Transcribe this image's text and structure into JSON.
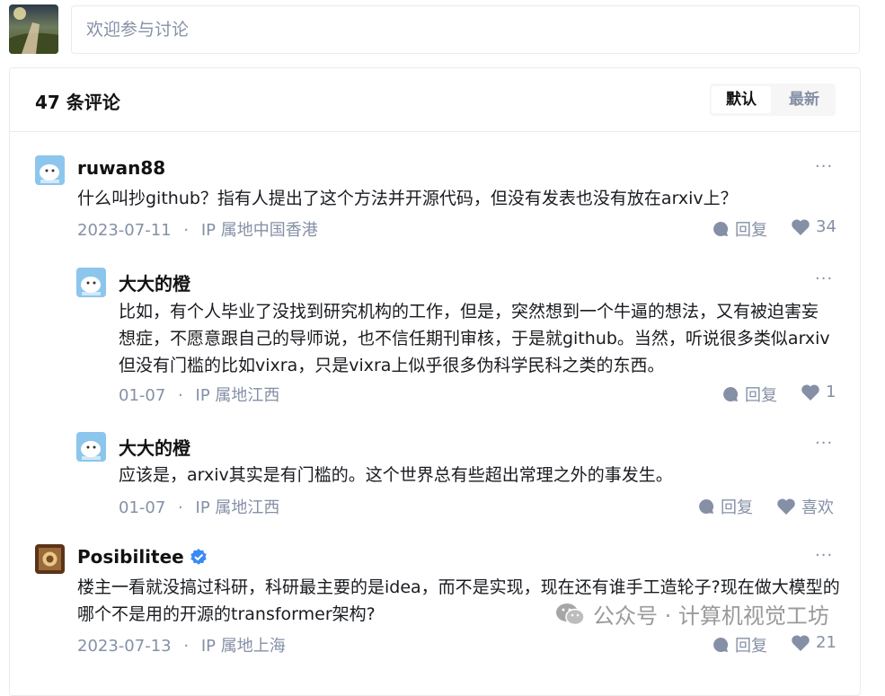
{
  "input": {
    "placeholder": "欢迎参与讨论"
  },
  "header": {
    "count_label": "47 条评论",
    "sort_default": "默认",
    "sort_latest": "最新"
  },
  "comments": [
    {
      "author": "ruwan88",
      "content": "什么叫抄github？指有人提出了这个方法并开源代码，但没有发表也没有放在arxiv上？",
      "date": "2023-07-11",
      "ip": "IP 属地中国香港",
      "reply": "回复",
      "likes": "34"
    },
    {
      "author": "大大的橙",
      "content": "比如，有个人毕业了没找到研究机构的工作，但是，突然想到一个牛逼的想法，又有被迫害妄想症，不愿意跟自己的导师说，也不信任期刊审核，于是就github。当然，听说很多类似arxiv但没有门槛的比如vixra，只是vixra上似乎很多伪科学民科之类的东西。",
      "date": "01-07",
      "ip": "IP 属地江西",
      "reply": "回复",
      "likes": "1"
    },
    {
      "author": "大大的橙",
      "content": "应该是，arxiv其实是有门槛的。这个世界总有些超出常理之外的事发生。",
      "date": "01-07",
      "ip": "IP 属地江西",
      "reply": "回复",
      "likes": "喜欢"
    },
    {
      "author": "Posibilitee",
      "content": "楼主一看就没搞过科研，科研最主要的是idea，而不是实现，现在还有谁手工造轮子?现在做大模型的哪个不是用的开源的transformer架构?",
      "date": "2023-07-13",
      "ip": "IP 属地上海",
      "reply": "回复",
      "likes": "21"
    }
  ],
  "separator": "·",
  "more_glyph": "···",
  "watermark": "公众号 · 计算机视觉工坊",
  "colors": {
    "muted": "#8590a6",
    "verified": "#3a8af5",
    "text": "#191b1f"
  }
}
